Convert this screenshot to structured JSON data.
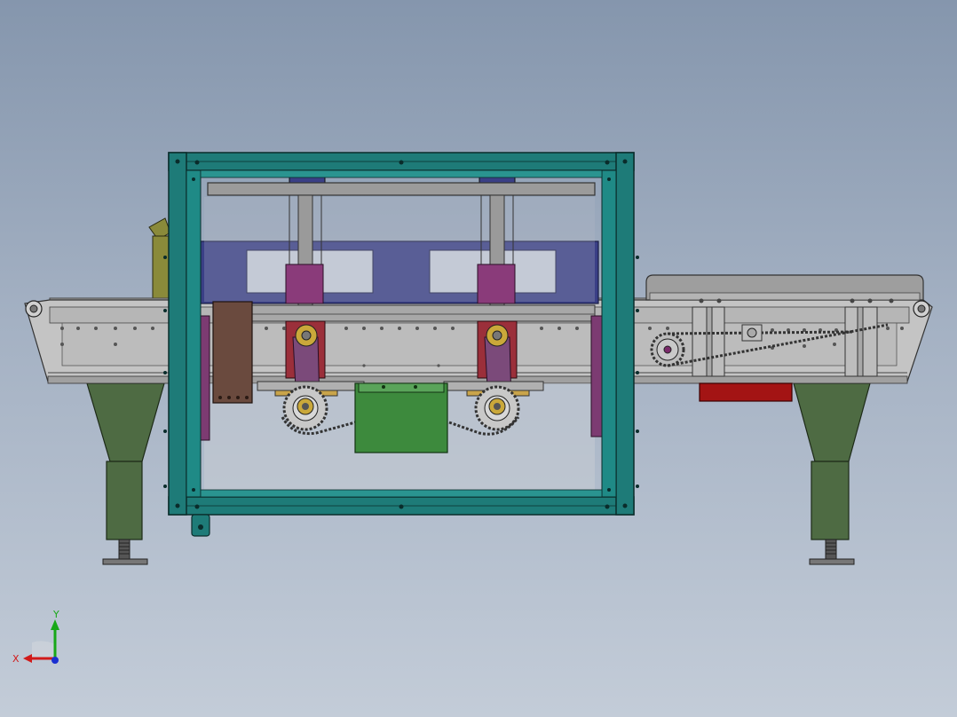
{
  "viewport": {
    "background_top": "#8596ad",
    "background_bottom": "#c3ccd8"
  },
  "model": {
    "frame_color": "#1e7b78",
    "conveyor_color": "#bdbdbd",
    "leg_color": "#4e6b43",
    "motor_color": "#3d8a3d",
    "fixture_color": "#3a3f86",
    "clamp_color": "#9b2f3a",
    "heater_color": "#a31414"
  },
  "triad": {
    "x_label": "X",
    "y_label": "Y",
    "x_color": "#d11a1a",
    "y_color": "#18a818",
    "z_color": "#1a2fd1"
  }
}
